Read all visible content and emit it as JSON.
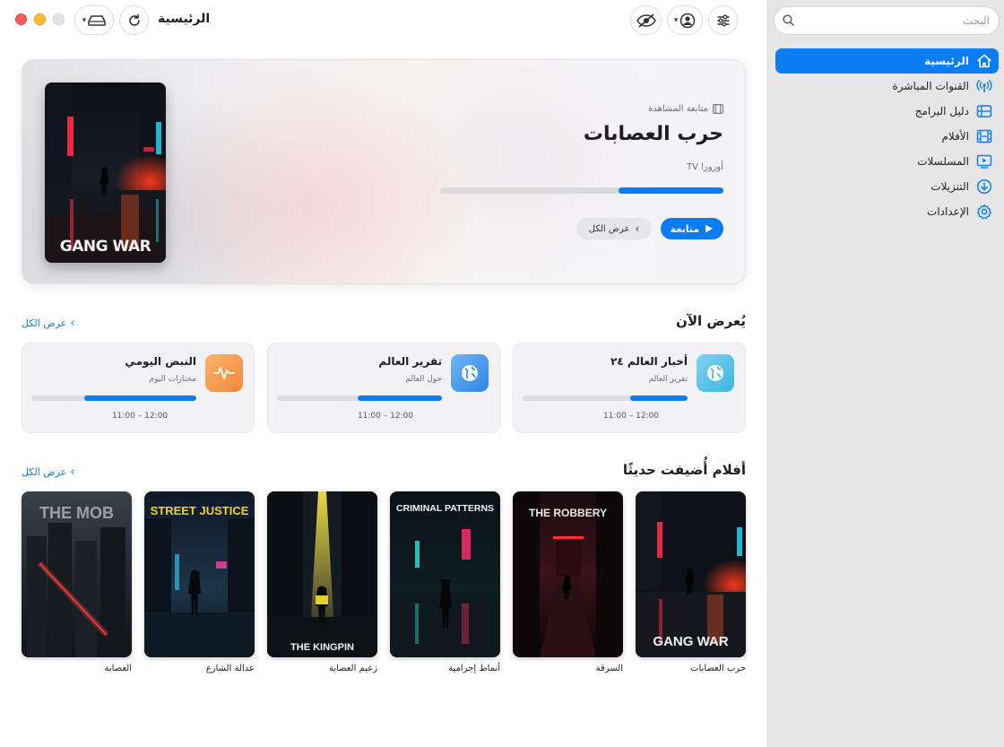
{
  "header": {
    "title": "الرئيسية"
  },
  "search": {
    "placeholder": "البحث"
  },
  "sidebar": {
    "items": [
      {
        "label": "الرئيسية",
        "icon": "house-icon",
        "active": true
      },
      {
        "label": "القنوات المباشرة",
        "icon": "antenna-icon",
        "active": false
      },
      {
        "label": "دليل البرامج",
        "icon": "guide-icon",
        "active": false
      },
      {
        "label": "الأفلام",
        "icon": "film-icon",
        "active": false
      },
      {
        "label": "المسلسلات",
        "icon": "tv-icon",
        "active": false
      },
      {
        "label": "التنزيلات",
        "icon": "download-icon",
        "active": false
      },
      {
        "label": "الإعدادات",
        "icon": "gear-icon",
        "active": false
      }
    ]
  },
  "hero": {
    "kicker": "متابعة المشاهدة",
    "title": "حرب العصابات",
    "channel": "أورورا TV",
    "progress": 0.37,
    "play_label": "متابعة",
    "view_all_label": "عرض الكل",
    "poster_text": "GANG WAR"
  },
  "now_showing": {
    "title": "يُعرض الآن",
    "view_all": "عرض الكل",
    "channels": [
      {
        "name": "أخبار العالم ٢٤",
        "subtitle": "تقرير العالم",
        "time": "11:00 – 12:00",
        "progress": 0.35,
        "icon": "globe-icon",
        "color": "#5ec3ec"
      },
      {
        "name": "تقرير العالم",
        "subtitle": "حول العالم",
        "time": "11:00 – 12:00",
        "progress": 0.51,
        "icon": "globe-icon",
        "color": "#4a9ff0"
      },
      {
        "name": "النبض اليومي",
        "subtitle": "مختارات اليوم",
        "time": "11:00 – 12:00",
        "progress": 0.68,
        "icon": "pulse-icon",
        "color": "#f59a4c"
      }
    ]
  },
  "new_movies": {
    "title": "أفلام أُضيفت حديثًا",
    "view_all": "عرض الكل",
    "movies": [
      {
        "title": "حرب العصابات",
        "poster_text": "GANG WAR"
      },
      {
        "title": "السرقة",
        "poster_text": "THE ROBBERY"
      },
      {
        "title": "أنماط إجرامية",
        "poster_text": "CRIMINAL PATTERNS"
      },
      {
        "title": "زعيم العصابة",
        "poster_text": "THE KINGPIN"
      },
      {
        "title": "عدالة الشارع",
        "poster_text": "STREET JUSTICE"
      },
      {
        "title": "العصابة",
        "poster_text": "THE MOB"
      }
    ]
  },
  "colors": {
    "accent": "#0a7cf4",
    "sidebar_bg": "#e7e6e6"
  }
}
